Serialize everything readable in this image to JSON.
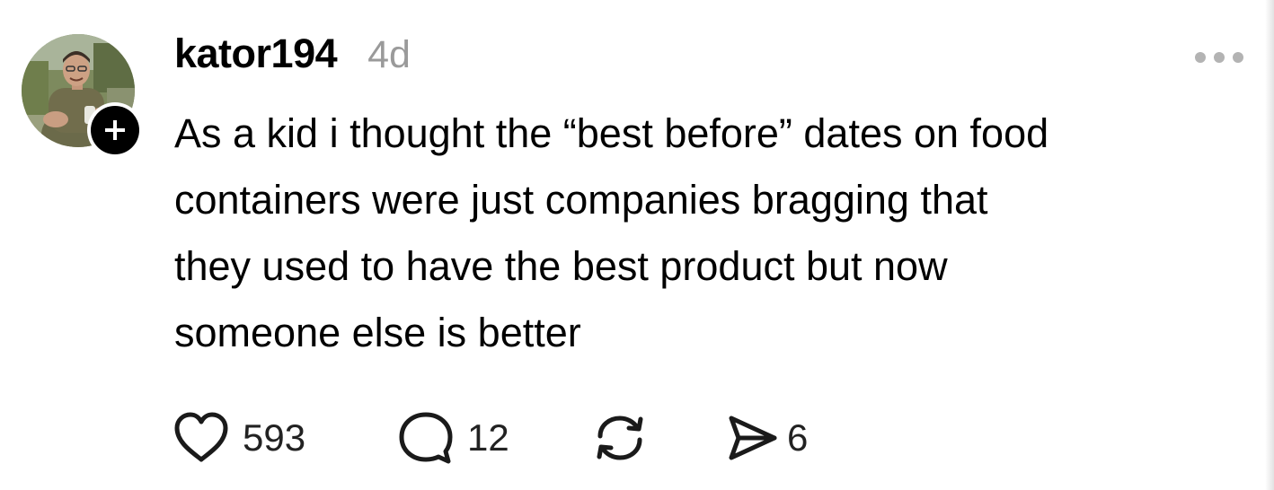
{
  "post": {
    "username": "kator194",
    "timestamp": "4d",
    "body_lines": [
      "As a kid i thought the “best before” dates on food",
      "containers were just companies bragging that",
      "they used to have the best product but now",
      "someone else is better"
    ]
  },
  "actions": {
    "likes": "593",
    "replies": "12",
    "shares": "6"
  },
  "icons": {
    "follow": "plus-icon",
    "more": "more-horizontal-icon",
    "like": "heart-icon",
    "reply": "speech-bubble-icon",
    "repost": "repost-icon",
    "share": "send-icon"
  },
  "colors": {
    "text": "#000000",
    "muted": "#9a9a9a",
    "background": "#ffffff"
  }
}
